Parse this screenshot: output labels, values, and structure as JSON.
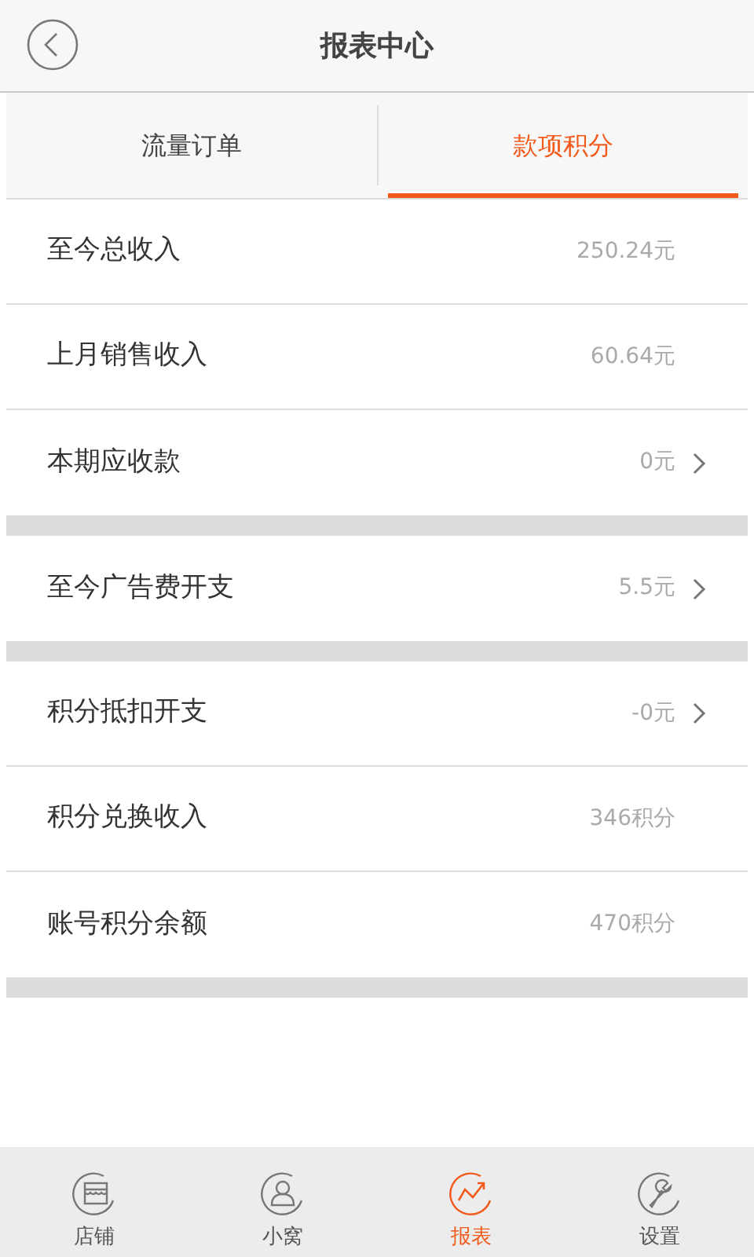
{
  "header": {
    "title": "报表中心"
  },
  "tabs": [
    {
      "label": "流量订单",
      "selected": false
    },
    {
      "label": "款项积分",
      "selected": true
    }
  ],
  "groups": [
    {
      "rows": [
        {
          "label": "至今总收入",
          "value": "250.24元",
          "arrow": false
        },
        {
          "label": "上月销售收入",
          "value": "60.64元",
          "arrow": false
        },
        {
          "label": "本期应收款",
          "value": "0元",
          "arrow": true
        }
      ]
    },
    {
      "rows": [
        {
          "label": "至今广告费开支",
          "value": "5.5元",
          "arrow": true
        }
      ]
    },
    {
      "rows": [
        {
          "label": "积分抵扣开支",
          "value": "-0元",
          "arrow": true
        },
        {
          "label": "积分兑换收入",
          "value": "346积分",
          "arrow": false
        },
        {
          "label": "账号积分余额",
          "value": "470积分",
          "arrow": false
        }
      ]
    }
  ],
  "bottom_nav": [
    {
      "label": "店铺",
      "kind": "shop",
      "selected": false
    },
    {
      "label": "小窝",
      "kind": "person",
      "selected": false
    },
    {
      "label": "报表",
      "kind": "chart",
      "selected": true
    },
    {
      "label": "设置",
      "kind": "wrench",
      "selected": false
    }
  ]
}
